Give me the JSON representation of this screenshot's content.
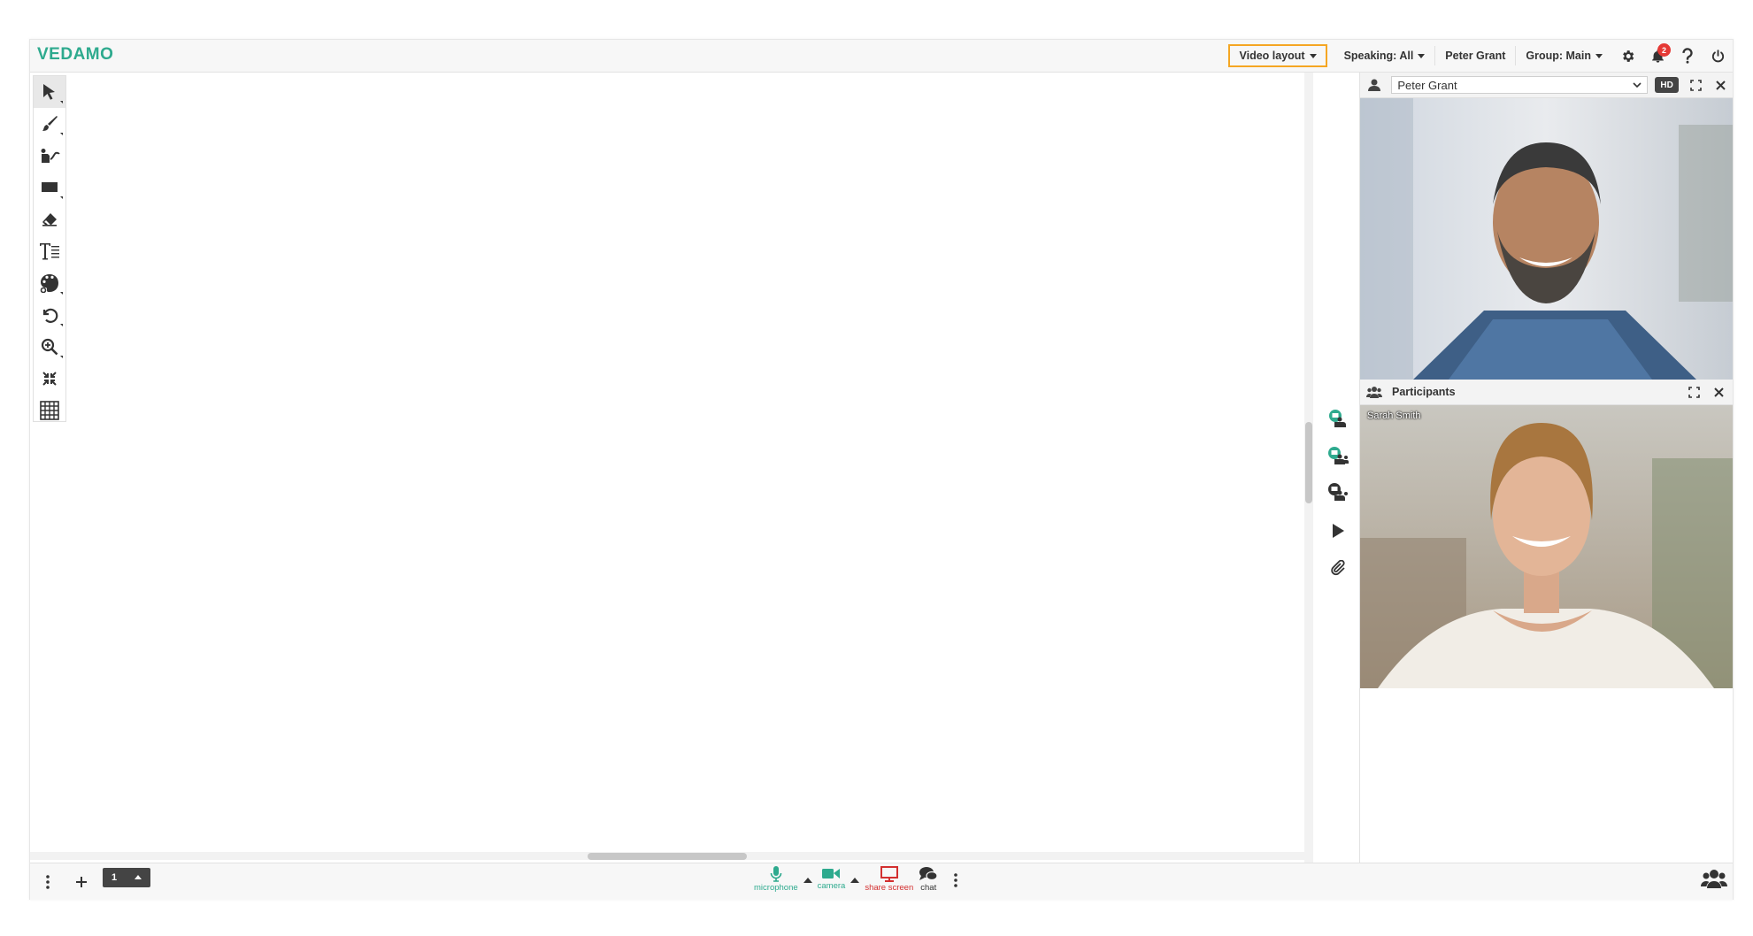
{
  "app": {
    "logo": "VEDAMO"
  },
  "topbar": {
    "video_layout": "Video layout",
    "speaking": "Speaking: All",
    "user": "Peter Grant",
    "group": "Group: Main",
    "notifications_count": "2",
    "icons": [
      "gear-icon",
      "bell-icon",
      "help-icon",
      "power-icon"
    ]
  },
  "tools": [
    "select",
    "brush",
    "hand-draw",
    "rectangle",
    "eraser",
    "text",
    "palette",
    "undo",
    "zoom",
    "fit-screen",
    "grid"
  ],
  "side_icons": [
    "presenter-icon",
    "group-presenter-icon",
    "screen-share-icon",
    "play-icon",
    "attachment-icon"
  ],
  "video_panel": {
    "selected_user": "Peter Grant",
    "hd_label": "HD"
  },
  "participants": {
    "title": "Participants",
    "name": "Sarah Smith"
  },
  "bottombar": {
    "page_number": "1",
    "microphone": "microphone",
    "camera": "camera",
    "share_screen": "share screen",
    "chat": "chat"
  },
  "colors": {
    "brand": "#2eaa8e",
    "highlight": "#f5a623",
    "share": "#d32f2f",
    "badge": "#e53935"
  }
}
